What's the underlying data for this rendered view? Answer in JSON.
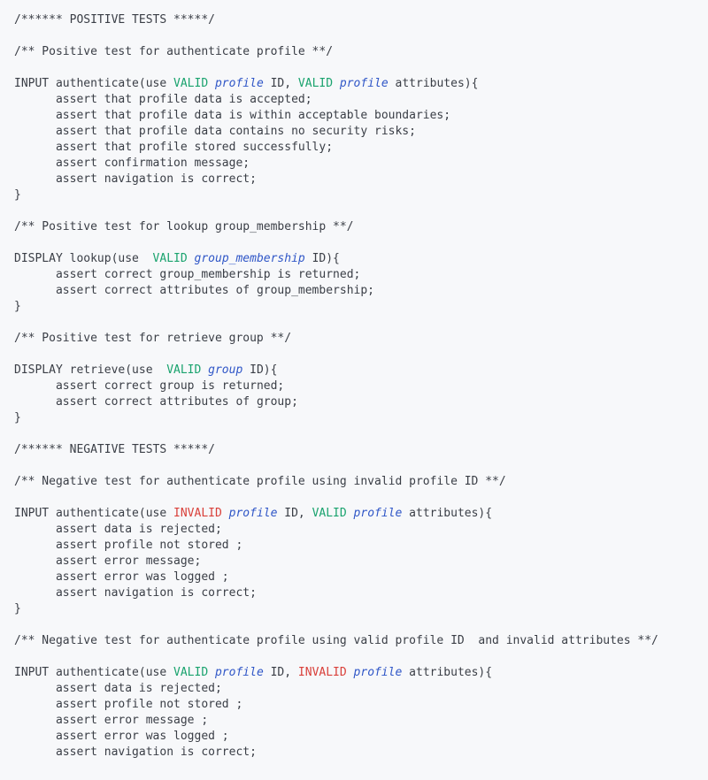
{
  "tokens": {
    "VALID": "VALID",
    "INVALID": "INVALID",
    "profile": "profile",
    "group": "group",
    "group_membership": "group_membership"
  },
  "lines": [
    {
      "indent": 0,
      "segs": [
        {
          "t": "/****** POSITIVE TESTS *****/"
        }
      ]
    },
    {
      "blank": true
    },
    {
      "indent": 0,
      "segs": [
        {
          "t": "/** Positive test for authenticate profile **/"
        }
      ]
    },
    {
      "blank": true
    },
    {
      "indent": 0,
      "segs": [
        {
          "t": "INPUT authenticate(use "
        },
        {
          "k": "VALID"
        },
        {
          "t": " "
        },
        {
          "e": "profile"
        },
        {
          "t": " ID, "
        },
        {
          "k": "VALID"
        },
        {
          "t": " "
        },
        {
          "e": "profile"
        },
        {
          "t": " attributes){"
        }
      ]
    },
    {
      "indent": 1,
      "segs": [
        {
          "t": "assert that profile data is accepted;"
        }
      ]
    },
    {
      "indent": 1,
      "segs": [
        {
          "t": "assert that profile data is within acceptable boundaries;"
        }
      ]
    },
    {
      "indent": 1,
      "segs": [
        {
          "t": "assert that profile data contains no security risks;"
        }
      ]
    },
    {
      "indent": 1,
      "segs": [
        {
          "t": "assert that profile stored successfully;"
        }
      ]
    },
    {
      "indent": 1,
      "segs": [
        {
          "t": "assert confirmation message;"
        }
      ]
    },
    {
      "indent": 1,
      "segs": [
        {
          "t": "assert navigation is correct;"
        }
      ]
    },
    {
      "indent": 0,
      "segs": [
        {
          "t": "}"
        }
      ]
    },
    {
      "blank": true
    },
    {
      "indent": 0,
      "segs": [
        {
          "t": "/** Positive test for lookup group_membership **/"
        }
      ]
    },
    {
      "blank": true
    },
    {
      "indent": 0,
      "segs": [
        {
          "t": "DISPLAY lookup(use  "
        },
        {
          "k": "VALID"
        },
        {
          "t": " "
        },
        {
          "e": "group_membership"
        },
        {
          "t": " ID){"
        }
      ]
    },
    {
      "indent": 1,
      "segs": [
        {
          "t": "assert correct group_membership is returned;"
        }
      ]
    },
    {
      "indent": 1,
      "segs": [
        {
          "t": "assert correct attributes of group_membership;"
        }
      ]
    },
    {
      "indent": 0,
      "segs": [
        {
          "t": "}"
        }
      ]
    },
    {
      "blank": true
    },
    {
      "indent": 0,
      "segs": [
        {
          "t": "/** Positive test for retrieve group **/"
        }
      ]
    },
    {
      "blank": true
    },
    {
      "indent": 0,
      "segs": [
        {
          "t": "DISPLAY retrieve(use  "
        },
        {
          "k": "VALID"
        },
        {
          "t": " "
        },
        {
          "e": "group"
        },
        {
          "t": " ID){"
        }
      ]
    },
    {
      "indent": 1,
      "segs": [
        {
          "t": "assert correct group is returned;"
        }
      ]
    },
    {
      "indent": 1,
      "segs": [
        {
          "t": "assert correct attributes of group;"
        }
      ]
    },
    {
      "indent": 0,
      "segs": [
        {
          "t": "}"
        }
      ]
    },
    {
      "blank": true
    },
    {
      "indent": 0,
      "segs": [
        {
          "t": "/****** NEGATIVE TESTS *****/"
        }
      ]
    },
    {
      "blank": true
    },
    {
      "indent": 0,
      "segs": [
        {
          "t": "/** Negative test for authenticate profile using invalid profile ID **/"
        }
      ]
    },
    {
      "blank": true
    },
    {
      "indent": 0,
      "segs": [
        {
          "t": "INPUT authenticate(use "
        },
        {
          "k": "INVALID"
        },
        {
          "t": " "
        },
        {
          "e": "profile"
        },
        {
          "t": " ID, "
        },
        {
          "k": "VALID"
        },
        {
          "t": " "
        },
        {
          "e": "profile"
        },
        {
          "t": " attributes){"
        }
      ]
    },
    {
      "indent": 1,
      "segs": [
        {
          "t": "assert data is rejected;"
        }
      ]
    },
    {
      "indent": 1,
      "segs": [
        {
          "t": "assert profile not stored ;"
        }
      ]
    },
    {
      "indent": 1,
      "segs": [
        {
          "t": "assert error message;"
        }
      ]
    },
    {
      "indent": 1,
      "segs": [
        {
          "t": "assert error was logged ;"
        }
      ]
    },
    {
      "indent": 1,
      "segs": [
        {
          "t": "assert navigation is correct;"
        }
      ]
    },
    {
      "indent": 0,
      "segs": [
        {
          "t": "}"
        }
      ]
    },
    {
      "blank": true
    },
    {
      "indent": 0,
      "segs": [
        {
          "t": "/** Negative test for authenticate profile using valid profile ID  and invalid attributes **/"
        }
      ]
    },
    {
      "blank": true
    },
    {
      "indent": 0,
      "segs": [
        {
          "t": "INPUT authenticate(use "
        },
        {
          "k": "VALID"
        },
        {
          "t": " "
        },
        {
          "e": "profile"
        },
        {
          "t": " ID, "
        },
        {
          "k": "INVALID"
        },
        {
          "t": " "
        },
        {
          "e": "profile"
        },
        {
          "t": " attributes){"
        }
      ]
    },
    {
      "indent": 1,
      "segs": [
        {
          "t": "assert data is rejected;"
        }
      ]
    },
    {
      "indent": 1,
      "segs": [
        {
          "t": "assert profile not stored ;"
        }
      ]
    },
    {
      "indent": 1,
      "segs": [
        {
          "t": "assert error message ;"
        }
      ]
    },
    {
      "indent": 1,
      "segs": [
        {
          "t": "assert error was logged ;"
        }
      ]
    },
    {
      "indent": 1,
      "segs": [
        {
          "t": "assert navigation is correct;"
        }
      ]
    }
  ]
}
